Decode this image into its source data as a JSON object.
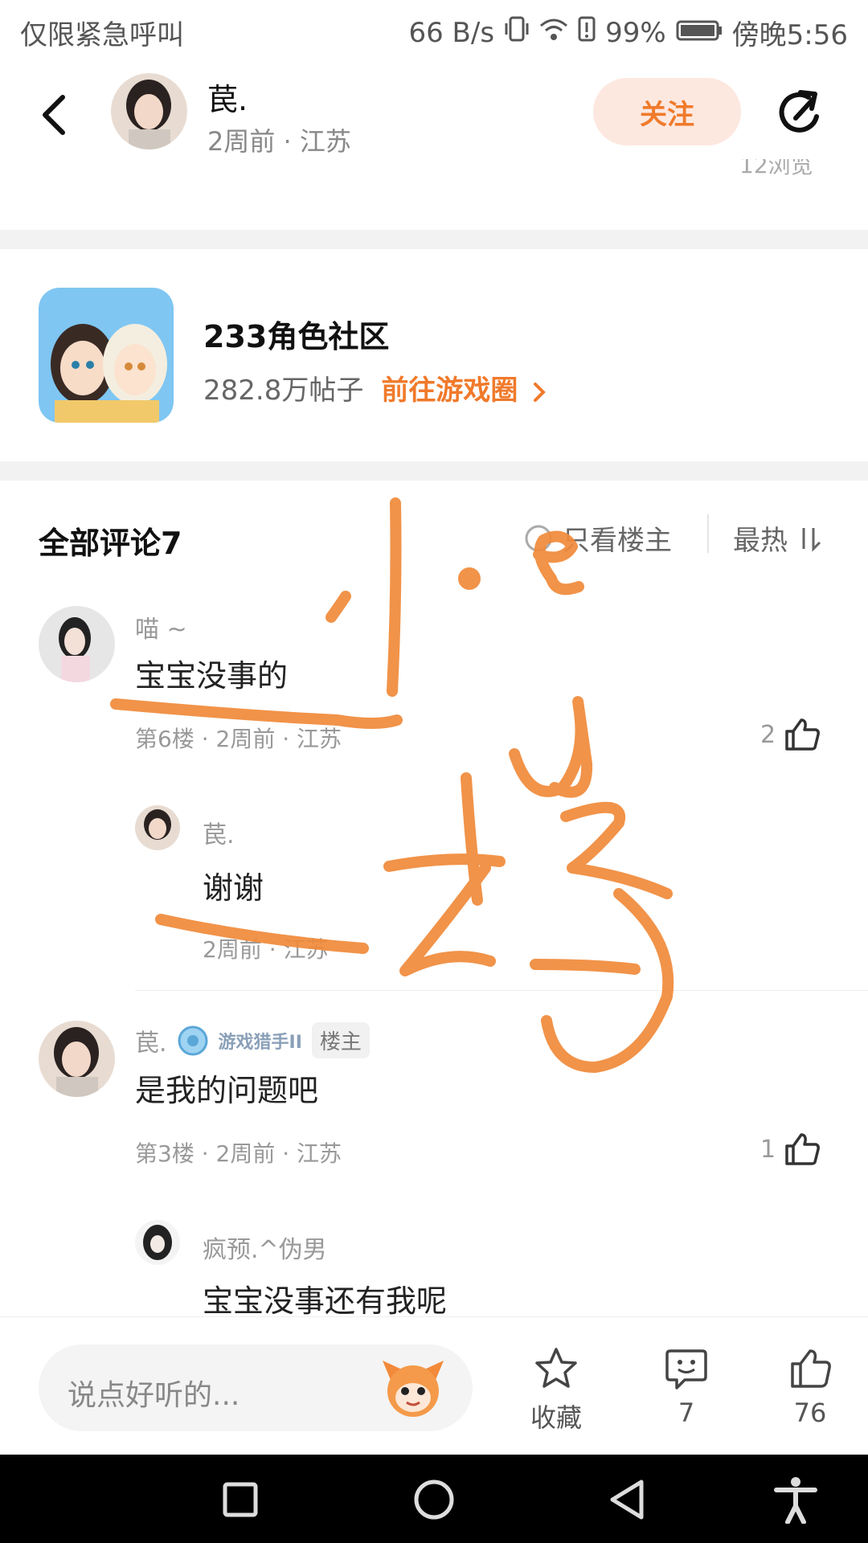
{
  "status_bar": {
    "left_text": "仅限紧急呼叫",
    "network_speed": "66 B/s",
    "battery": "99%",
    "time": "傍晚5:56"
  },
  "header": {
    "username": "苠.",
    "meta": "2周前 · 江苏",
    "follow_label": "关注",
    "truncated_views_text": "12浏览"
  },
  "community": {
    "name": "233角色社区",
    "posts_count": "282.8万帖子",
    "link_text": "前往游戏圈"
  },
  "comments": {
    "title": "全部评论7",
    "only_owner_label": "只看楼主",
    "sort_label": "最热",
    "items": [
      {
        "name": "喵 ~",
        "text": "宝宝没事的",
        "meta": "第6楼 · 2周前 · 江苏",
        "likes": "2",
        "reply": {
          "name": "苠.",
          "text": "谢谢",
          "meta": "2周前 · 江苏"
        }
      },
      {
        "name": "苠.",
        "badge": "游戏猎手II",
        "owner_tag": "楼主",
        "text": "是我的问题吧",
        "meta": "第3楼 · 2周前 · 江苏",
        "likes": "1",
        "reply": {
          "name": "疯预.^伪男",
          "text": "宝宝没事还有我呢"
        }
      }
    ]
  },
  "bottom_bar": {
    "placeholder": "说点好听的...",
    "collect_label": "收藏",
    "comment_count": "7",
    "like_count": "76"
  },
  "colors": {
    "accent": "#f07a2b",
    "scribble": "#f08a3a",
    "follow_bg": "#fde8e0"
  }
}
